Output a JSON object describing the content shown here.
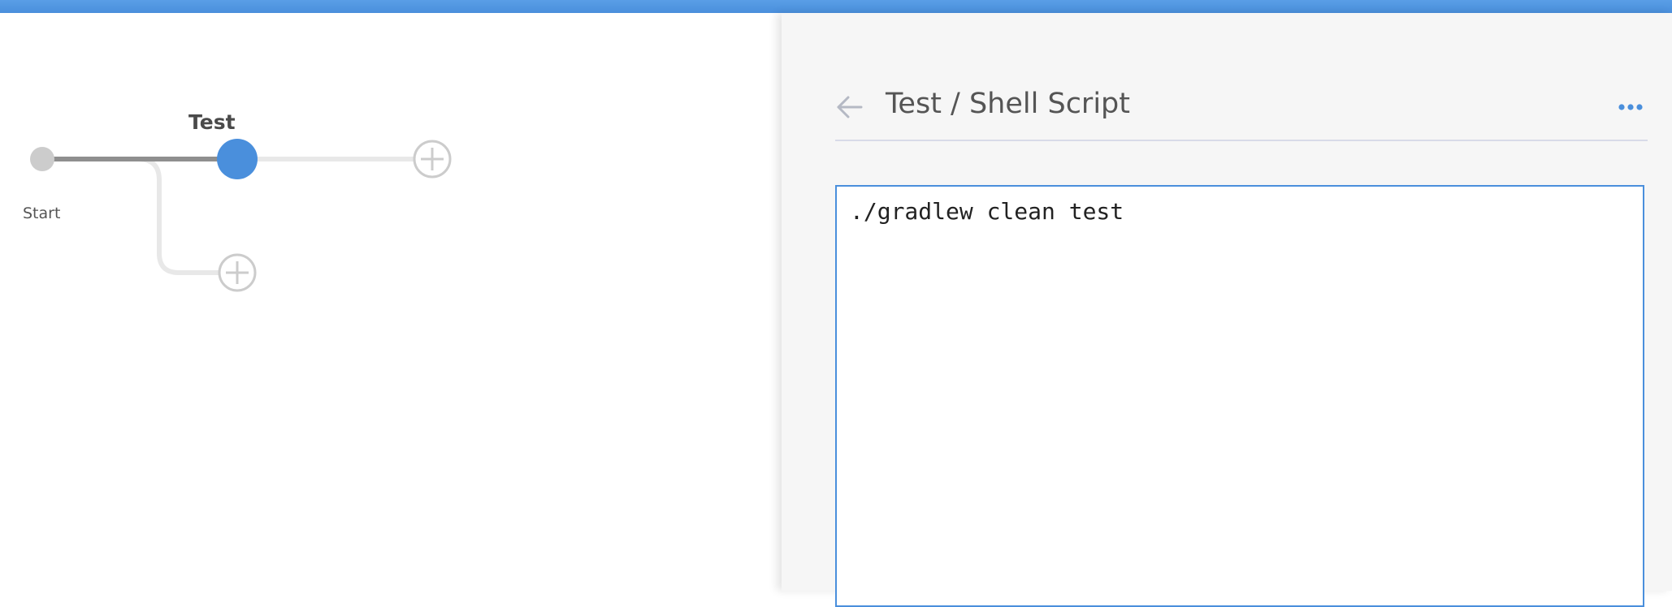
{
  "pipeline": {
    "stage_name": "Test",
    "start_label": "Start"
  },
  "panel": {
    "title": "Test / Shell Script"
  },
  "script": {
    "value": "./gradlew clean test"
  },
  "colors": {
    "accent": "#4a8fdc",
    "panel_bg": "#f6f6f6",
    "node_grey": "#cccccc",
    "line_dark": "#8f8f8f",
    "line_light": "#e8e8e8"
  },
  "icons": {
    "back": "arrow-left-icon",
    "more": "more-horizontal-icon",
    "add": "plus-circle-icon"
  }
}
